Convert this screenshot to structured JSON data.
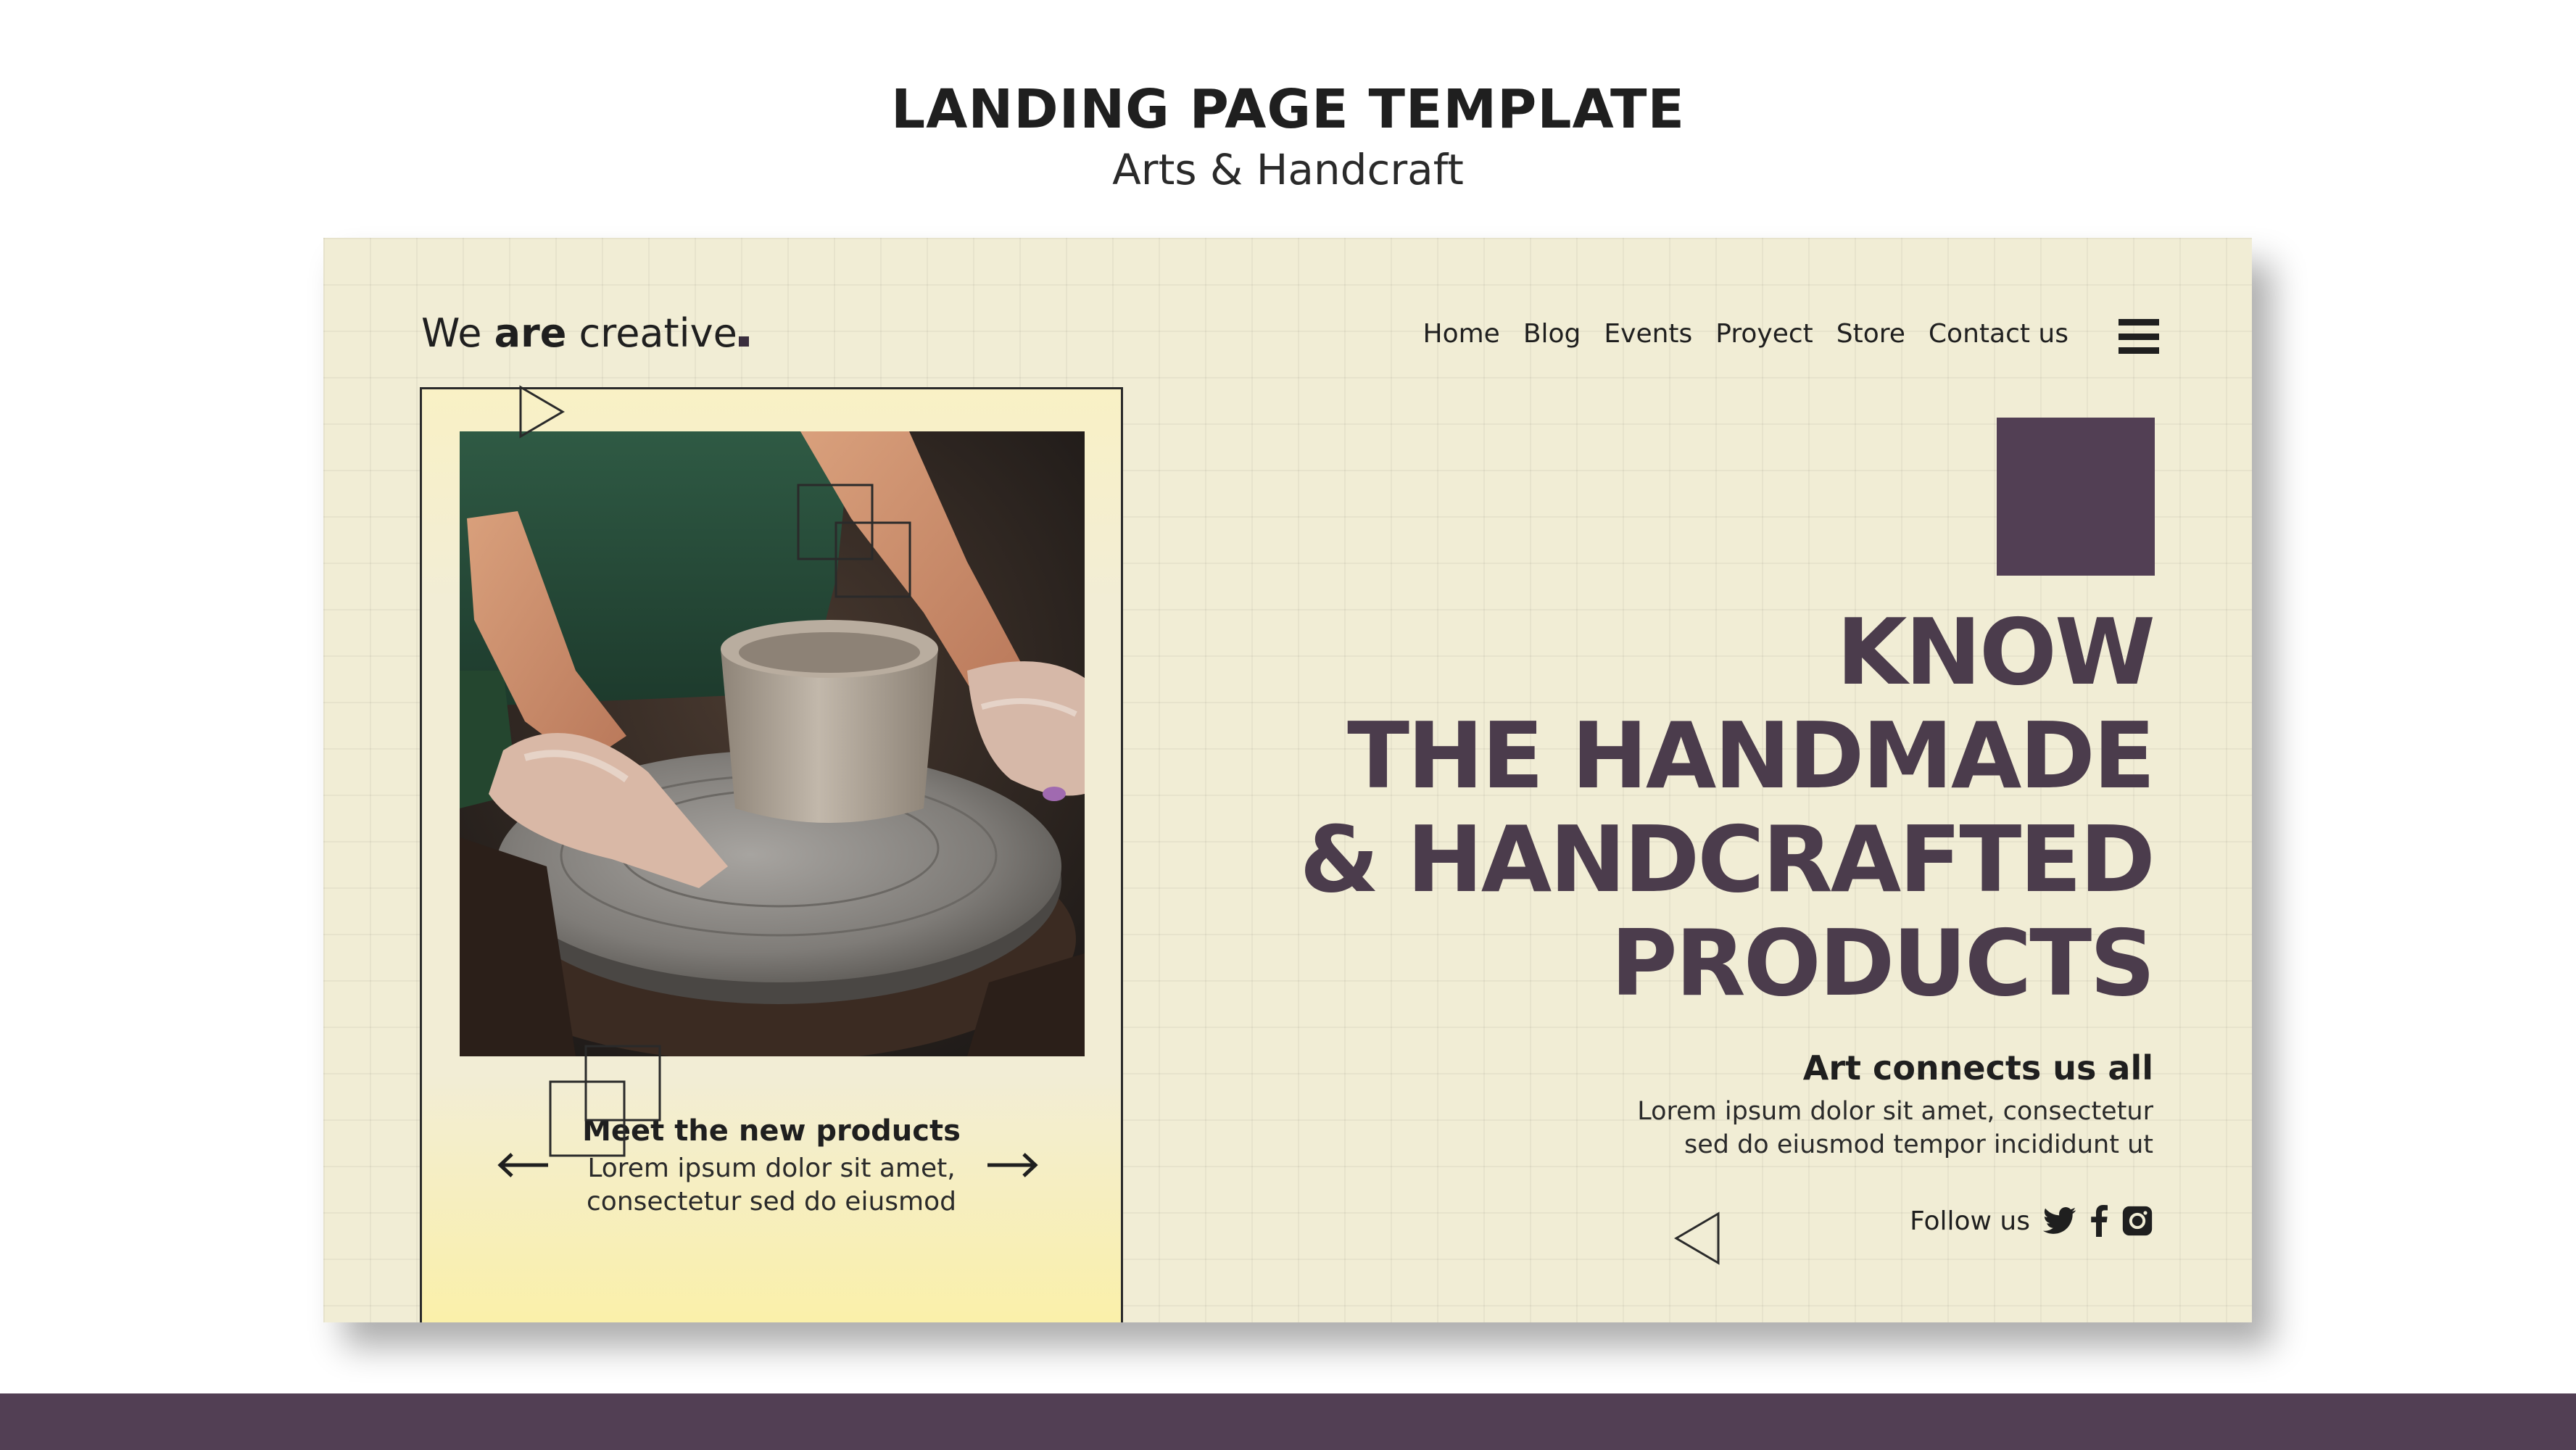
{
  "header": {
    "title": "LANDING PAGE TEMPLATE",
    "subtitle": "Arts & Handcraft"
  },
  "site": {
    "logo": {
      "part1": "We ",
      "bold": "are",
      "part2": " creative"
    },
    "nav": [
      "Home",
      "Blog",
      "Events",
      "Proyect",
      "Store",
      "Contact us"
    ],
    "menu_icon": "hamburger-menu-icon"
  },
  "card": {
    "title": "Meet the new products",
    "text_line1": "Lorem ipsum dolor sit amet,",
    "text_line2": "consectetur sed do eiusmod",
    "prev_icon": "arrow-left-icon",
    "next_icon": "arrow-right-icon"
  },
  "hero": {
    "headline": [
      "KNOW",
      "THE HANDMADE",
      "& HANDCRAFTED",
      "PRODUCTS"
    ],
    "tagline": "Art connects us all",
    "desc_line1": "Lorem ipsum dolor sit amet, consectetur",
    "desc_line2": "sed do eiusmod tempor incididunt ut",
    "follow_label": "Follow us",
    "social_icons": [
      "twitter-icon",
      "facebook-icon",
      "instagram-icon"
    ]
  },
  "colors": {
    "accent": "#523f54",
    "headline": "#4b3c4c",
    "background": "#f1edd5",
    "highlight": "#fbf0a6"
  }
}
